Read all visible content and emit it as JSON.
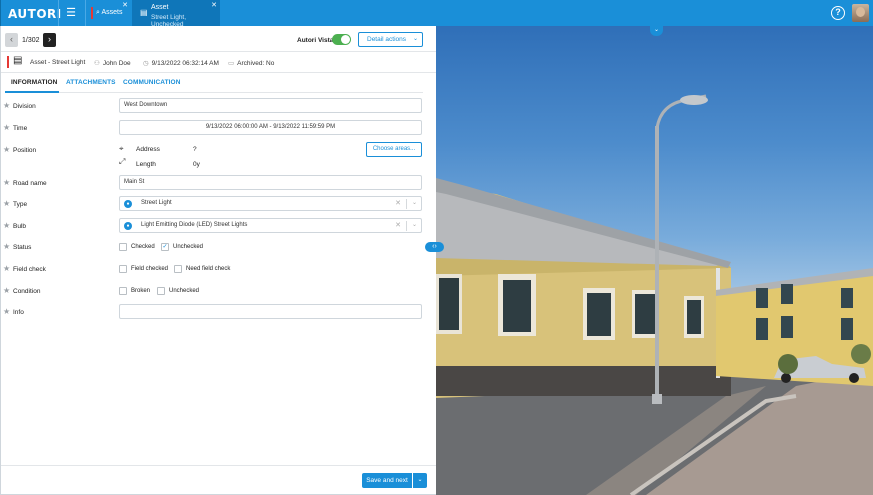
{
  "app": {
    "logo": "AUTORI"
  },
  "tabs": [
    {
      "label": "Assets"
    },
    {
      "label": "Asset",
      "sublabel": "Street Light, Unchecked"
    }
  ],
  "header": {
    "counter": "1/302",
    "vista_label": "Autori Vista",
    "vista_on": true,
    "detail_actions": "Detail actions"
  },
  "meta": {
    "asset": "Asset - Street Light",
    "user": "John Doe",
    "datetime": "9/13/2022 06:32:14 AM",
    "archived": "Archived: No"
  },
  "section_tabs": [
    "INFORMATION",
    "ATTACHMENTS",
    "COMMUNICATION"
  ],
  "form": {
    "division_label": "Division",
    "division_value": "West Downtown",
    "time_label": "Time",
    "time_value": "9/13/2022 06:00:00 AM - 9/13/2022 11:59:59 PM",
    "position_label": "Position",
    "address_label": "Address",
    "address_value": "?",
    "length_label": "Length",
    "length_value": "0y",
    "choose_areas": "Choose areas...",
    "road_label": "Road name",
    "road_value": "Main St",
    "type_label": "Type",
    "type_value": "Street Light",
    "bulb_label": "Bulb",
    "bulb_value": "Light Emitting Diode (LED) Street Lights",
    "status_label": "Status",
    "status_opts": [
      "Checked",
      "Unchecked"
    ],
    "field_label": "Field check",
    "field_opts": [
      "Field checked",
      "Need field check"
    ],
    "condition_label": "Condition",
    "condition_opts": [
      "Broken",
      "Unchecked"
    ],
    "info_label": "Info",
    "info_value": ""
  },
  "footer": {
    "save_next": "Save and next"
  },
  "colors": {
    "accent": "#1a8fd8",
    "status_red": "#e53935",
    "toggle_green": "#4caf50"
  }
}
